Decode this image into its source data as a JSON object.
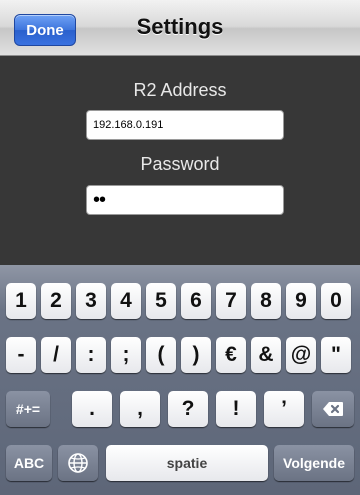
{
  "navbar": {
    "done_label": "Done",
    "title": "Settings"
  },
  "form": {
    "address_label": "R2 Address",
    "address_value": "192.168.0.191",
    "password_label": "Password",
    "password_value": "••"
  },
  "keyboard": {
    "row1": [
      "1",
      "2",
      "3",
      "4",
      "5",
      "6",
      "7",
      "8",
      "9",
      "0"
    ],
    "row2": [
      "-",
      "/",
      ":",
      ";",
      "(",
      ")",
      "€",
      "&",
      "@",
      "\""
    ],
    "row3_mode": "#+=",
    "row3": [
      ".",
      ",",
      "?",
      "!",
      "’"
    ],
    "row4_abc": "ABC",
    "row4_space": "spatie",
    "row4_return": "Volgende",
    "icons": {
      "globe": "globe-icon",
      "delete": "backspace-icon"
    }
  }
}
